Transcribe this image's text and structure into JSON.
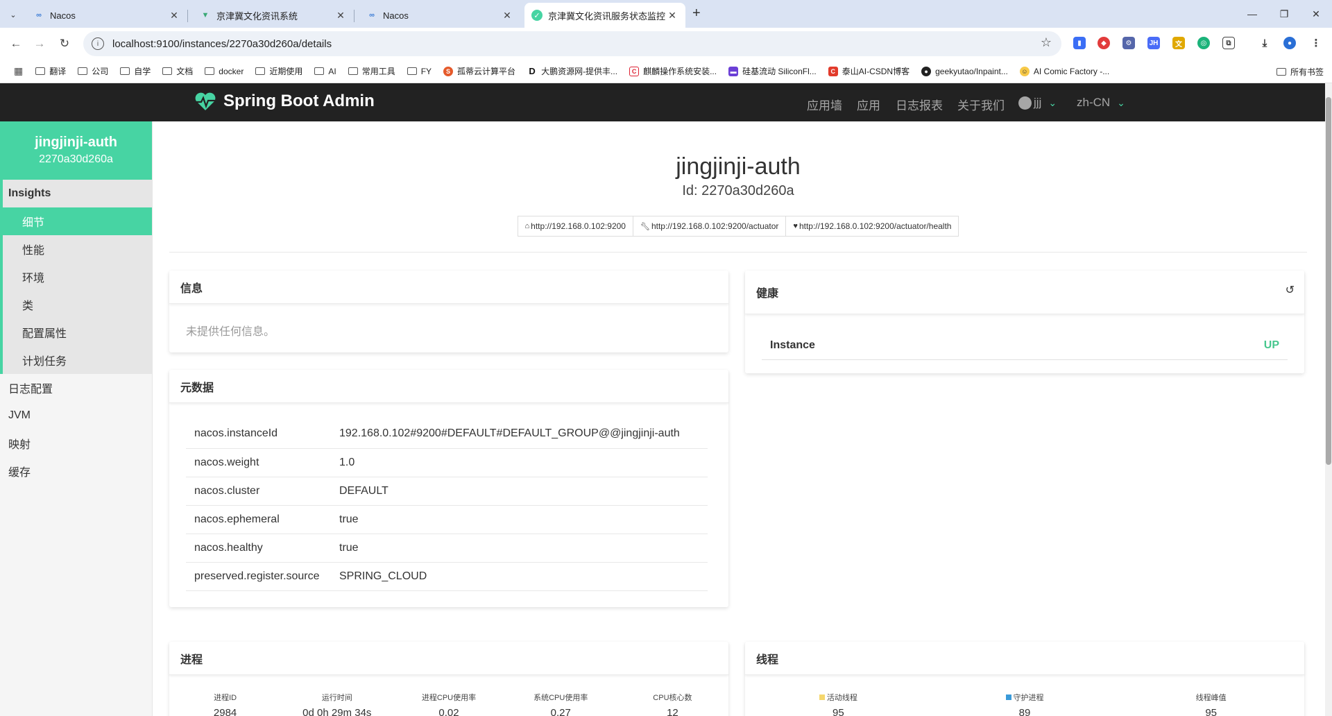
{
  "browser": {
    "tabs": [
      {
        "title": "Nacos",
        "icon": "nacos-icon"
      },
      {
        "title": "京津冀文化资讯系统",
        "icon": "vue-icon"
      },
      {
        "title": "Nacos",
        "icon": "nacos-icon"
      },
      {
        "title": "京津冀文化资讯服务状态监控",
        "icon": "sba-icon"
      }
    ],
    "url": "localhost:9100/instances/2270a30d260a/details",
    "bookmarks": [
      "翻译",
      "公司",
      "自学",
      "文档",
      "docker",
      "近期使用",
      "AI",
      "常用工具",
      "FY",
      "孤蒂云计算平台",
      "大鹏资源网-提供丰...",
      "麒麟操作系统安装...",
      "硅基流动 SiliconFl...",
      "泰山AI-CSDN博客",
      "geekyutao/Inpaint...",
      "AI Comic Factory -..."
    ],
    "bookmarks_right": "所有书签"
  },
  "app": {
    "brand": "Spring Boot Admin",
    "nav": [
      "应用墙",
      "应用",
      "日志报表",
      "关于我们"
    ],
    "user": "jjj",
    "locale": "zh-CN"
  },
  "sidebar": {
    "app_name": "jingjinji-auth",
    "instance_id": "2270a30d260a",
    "insights_label": "Insights",
    "insights_items": [
      "细节",
      "性能",
      "环境",
      "类",
      "配置属性",
      "计划任务"
    ],
    "items": [
      "日志配置",
      "JVM",
      "映射",
      "缓存"
    ]
  },
  "main": {
    "title": "jingjinji-auth",
    "id_line": "Id: 2270a30d260a",
    "links": [
      {
        "icon": "home-icon",
        "url": "http://192.168.0.102:9200"
      },
      {
        "icon": "wrench-icon",
        "url": "http://192.168.0.102:9200/actuator"
      },
      {
        "icon": "heart-icon",
        "url": "http://192.168.0.102:9200/actuator/health"
      }
    ],
    "info": {
      "title": "信息",
      "empty": "未提供任何信息。"
    },
    "metadata": {
      "title": "元数据",
      "rows": [
        {
          "key": "nacos.instanceId",
          "value": "192.168.0.102#9200#DEFAULT#DEFAULT_GROUP@@jingjinji-auth"
        },
        {
          "key": "nacos.weight",
          "value": "1.0"
        },
        {
          "key": "nacos.cluster",
          "value": "DEFAULT"
        },
        {
          "key": "nacos.ephemeral",
          "value": "true"
        },
        {
          "key": "nacos.healthy",
          "value": "true"
        },
        {
          "key": "preserved.register.source",
          "value": "SPRING_CLOUD"
        }
      ]
    },
    "health": {
      "title": "健康",
      "label": "Instance",
      "status": "UP"
    },
    "process": {
      "title": "进程",
      "stats": [
        {
          "label": "进程ID",
          "value": "2984"
        },
        {
          "label": "运行时间",
          "value": "0d 0h 29m 34s"
        },
        {
          "label": "进程CPU使用率",
          "value": "0.02"
        },
        {
          "label": "系统CPU使用率",
          "value": "0.27"
        },
        {
          "label": "CPU核心数",
          "value": "12"
        }
      ]
    },
    "threads": {
      "title": "线程",
      "stats": [
        {
          "label": "活动线程",
          "value": "95",
          "color": "#f5d76e"
        },
        {
          "label": "守护进程",
          "value": "89",
          "color": "#3a9ad9"
        },
        {
          "label": "线程峰值",
          "value": "95"
        }
      ]
    }
  },
  "colors": {
    "accent": "#47d4a3",
    "appbar": "#222222",
    "status_up": "#47c78e"
  }
}
